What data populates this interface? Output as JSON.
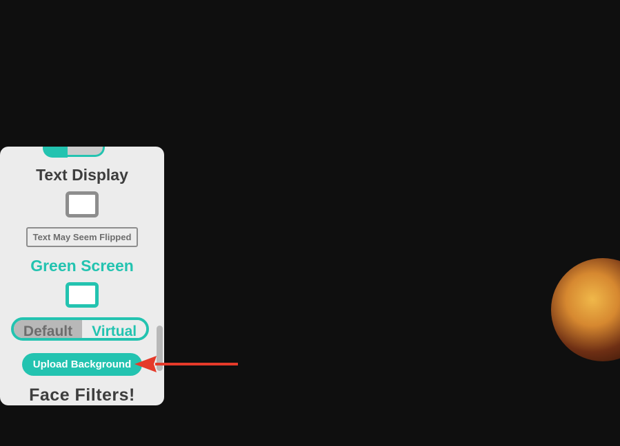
{
  "panel": {
    "textDisplay": {
      "title": "Text Display",
      "note": "Text May Seem Flipped"
    },
    "greenScreen": {
      "title": "Green Screen",
      "toggle": {
        "default": "Default",
        "virtual": "Virtual"
      },
      "upload": "Upload Background"
    },
    "faceFilters": {
      "title": "Face Filters!"
    }
  }
}
